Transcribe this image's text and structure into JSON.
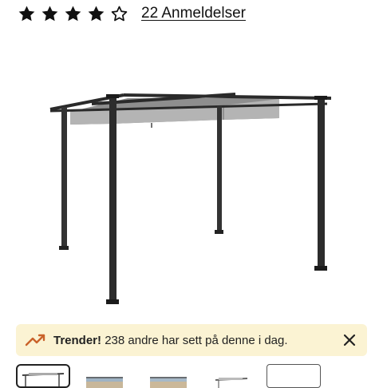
{
  "rating": {
    "stars": [
      {
        "icon": "star-filled-icon",
        "fill": 1
      },
      {
        "icon": "star-filled-icon",
        "fill": 1
      },
      {
        "icon": "star-filled-icon",
        "fill": 1
      },
      {
        "icon": "star-filled-icon",
        "fill": 1
      },
      {
        "icon": "star-outline-icon",
        "fill": 0
      }
    ],
    "value": 4,
    "max": 5,
    "reviews_link": "22 Anmeldelser"
  },
  "product_image": {
    "icon": "pergola-image"
  },
  "trend_banner": {
    "icon": "trending-up-icon",
    "title": "Trender!",
    "message": "238 andre har sett på denne i dag.",
    "close_icon": "close-icon",
    "background": "#fbf3d3",
    "icon_color": "#c9622a"
  },
  "thumbnails": [
    {
      "name": "thumbnail-pergola",
      "selected": true
    },
    {
      "name": "thumbnail-pergola-2",
      "selected": false
    },
    {
      "name": "thumbnail-pergola-3",
      "selected": false
    },
    {
      "name": "thumbnail-pergola-4",
      "selected": false
    },
    {
      "name": "thumbnail-more",
      "selected": false
    }
  ]
}
